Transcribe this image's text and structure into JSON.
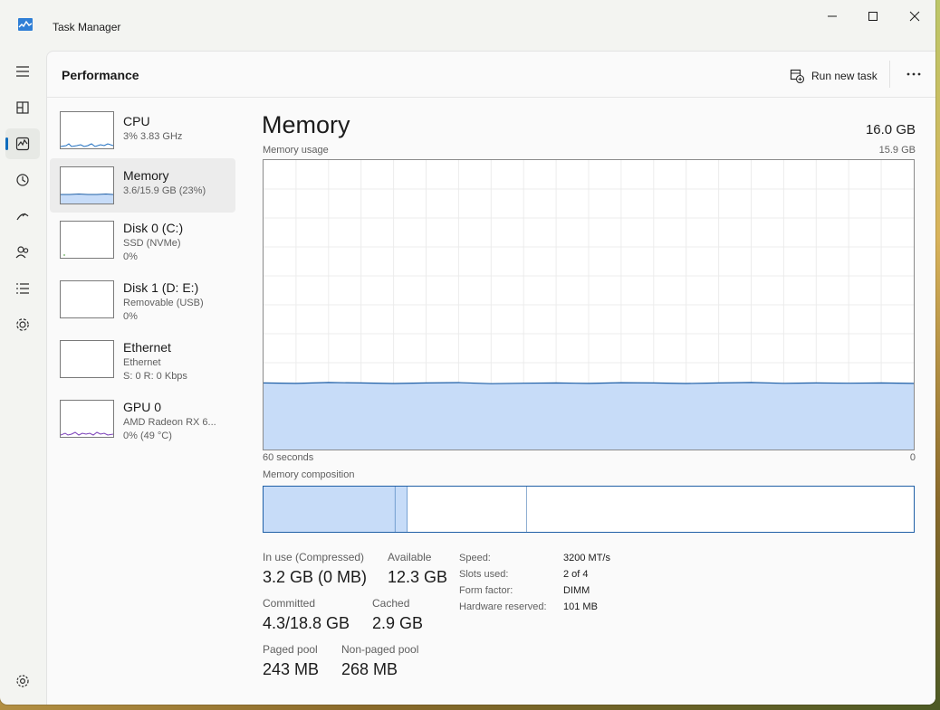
{
  "window": {
    "title": "Task Manager"
  },
  "header": {
    "title": "Performance",
    "run_new_task": "Run new task"
  },
  "nav": {
    "items": [
      {
        "icon": "hamburger-menu-icon"
      },
      {
        "icon": "processes-icon"
      },
      {
        "icon": "performance-icon",
        "active": true
      },
      {
        "icon": "app-history-icon"
      },
      {
        "icon": "startup-apps-icon"
      },
      {
        "icon": "users-icon"
      },
      {
        "icon": "details-icon"
      },
      {
        "icon": "services-icon"
      },
      {
        "icon": "settings-icon"
      }
    ]
  },
  "sidebar": {
    "items": [
      {
        "name": "CPU",
        "sub1": "3%  3.83 GHz",
        "sub2": ""
      },
      {
        "name": "Memory",
        "sub1": "3.6/15.9 GB (23%)",
        "sub2": "",
        "selected": true
      },
      {
        "name": "Disk 0 (C:)",
        "sub1": "SSD (NVMe)",
        "sub2": "0%"
      },
      {
        "name": "Disk 1 (D: E:)",
        "sub1": "Removable (USB)",
        "sub2": "0%"
      },
      {
        "name": "Ethernet",
        "sub1": "Ethernet",
        "sub2": "S: 0  R: 0 Kbps"
      },
      {
        "name": "GPU 0",
        "sub1": "AMD Radeon RX 6...",
        "sub2": "0%  (49 °C)"
      }
    ]
  },
  "memory": {
    "title": "Memory",
    "total": "16.0 GB",
    "usage_label": "Memory usage",
    "usage_max": "15.9 GB",
    "axis_left": "60 seconds",
    "axis_right": "0",
    "composition_label": "Memory composition",
    "usage_fraction": 0.23,
    "composition": {
      "in_use": 3.2,
      "modified": 0.3,
      "standby": 2.9,
      "free": 9.4
    },
    "stats": {
      "in_use_label": "In use (Compressed)",
      "in_use_value": "3.2 GB (0 MB)",
      "available_label": "Available",
      "available_value": "12.3 GB",
      "committed_label": "Committed",
      "committed_value": "4.3/18.8 GB",
      "cached_label": "Cached",
      "cached_value": "2.9 GB",
      "paged_label": "Paged pool",
      "paged_value": "243 MB",
      "nonpaged_label": "Non-paged pool",
      "nonpaged_value": "268 MB"
    },
    "specs": [
      {
        "key": "Speed:",
        "value": "3200 MT/s"
      },
      {
        "key": "Slots used:",
        "value": "2 of 4"
      },
      {
        "key": "Form factor:",
        "value": "DIMM"
      },
      {
        "key": "Hardware reserved:",
        "value": "101 MB"
      }
    ]
  },
  "colors": {
    "accent": "#0f6cbd",
    "mem_fill": "#c7dcf8",
    "mem_line": "#1f5fa6"
  }
}
